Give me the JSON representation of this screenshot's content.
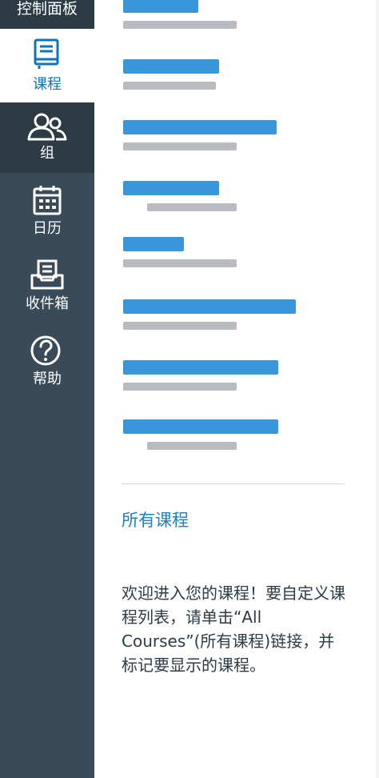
{
  "nav": {
    "dashboard": {
      "label": "控制面板",
      "icon": "dashboard-icon"
    },
    "courses": {
      "label": "课程",
      "icon": "book-icon"
    },
    "groups": {
      "label": "组",
      "icon": "users-icon"
    },
    "calendar": {
      "label": "日历",
      "icon": "calendar-icon"
    },
    "inbox": {
      "label": "收件箱",
      "icon": "inbox-icon"
    },
    "help": {
      "label": "帮助",
      "icon": "help-icon"
    }
  },
  "tray": {
    "courses": [
      {
        "title": "",
        "subtitle": ""
      },
      {
        "title": "",
        "subtitle": ""
      },
      {
        "title": "",
        "subtitle": ""
      },
      {
        "title": "",
        "subtitle": ""
      },
      {
        "title": "",
        "subtitle": ""
      },
      {
        "title": "",
        "subtitle": ""
      },
      {
        "title": "",
        "subtitle": ""
      },
      {
        "title": "",
        "subtitle": ""
      }
    ],
    "all_courses_link": "所有课程",
    "welcome_text": "欢迎进入您的课程！要自定义课程列表，请单击“All Courses”(所有课程)链接，并标记要显示的课程。"
  },
  "colors": {
    "nav_bg": "#394b58",
    "nav_active_bg": "#ffffff",
    "nav_dark_bg": "#2d3b45",
    "accent": "#0e73b8",
    "link": "#1f7fbf",
    "text": "#2d3b45"
  }
}
